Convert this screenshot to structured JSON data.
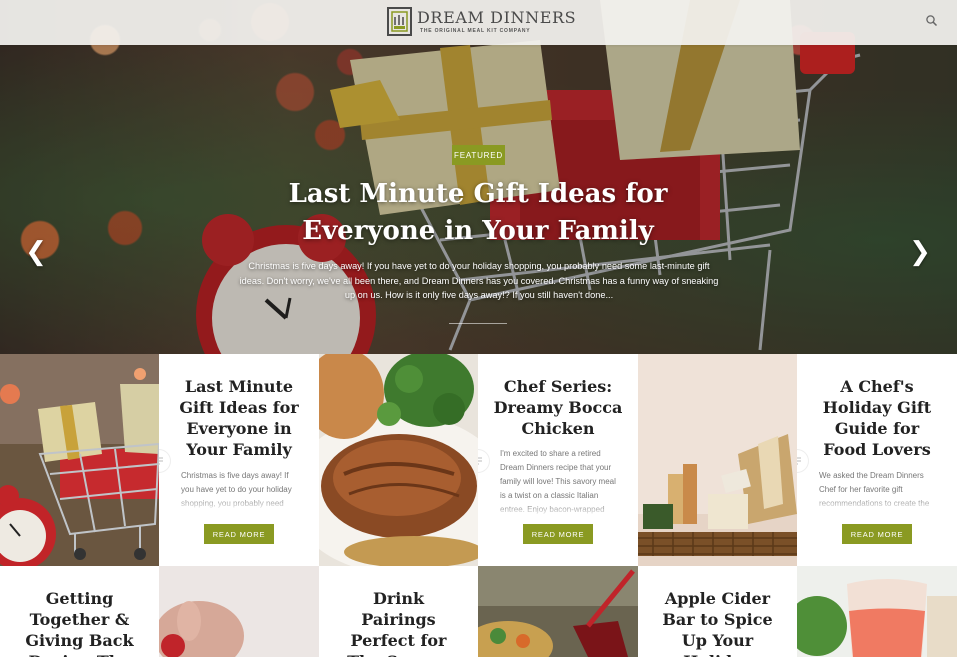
{
  "brand": {
    "name": "DREAM DINNERS",
    "tagline": "THE ORIGINAL MEAL KIT COMPANY"
  },
  "header": {
    "search_icon": "search-icon"
  },
  "hero": {
    "badge": "FEATURED",
    "title": "Last Minute Gift Ideas for Everyone in Your Family",
    "excerpt": "Christmas is five days away! If you have yet to do your holiday shopping, you probably need some last-minute gift ideas. Don't worry, we've all been there, and Dream Dinners has you covered. Christmas has a funny way of sneaking up on us. How is it only five days away!? If you still haven't done...",
    "prev_icon": "chevron-left-icon",
    "next_icon": "chevron-right-icon"
  },
  "posts": [
    {
      "title": "Last Minute Gift Ideas for Everyone in Your Family",
      "excerpt": "Christmas is five days away! If you have yet to do your holiday shopping, you probably need",
      "cta": "READ MORE"
    },
    {
      "title": "Chef Series: Dreamy Bocca Chicken",
      "excerpt": "I'm excited to share a retired Dream Dinners recipe that your family will love! This savory meal is a twist on a classic Italian entree. Enjoy bacon-wrapped",
      "cta": "READ MORE"
    },
    {
      "title": "A Chef's Holiday Gift Guide for Food Lovers",
      "excerpt": "We asked the Dream Dinners Chef for her favorite gift recommendations to create the",
      "cta": "READ MORE"
    },
    {
      "title": "Getting Together & Giving Back During The"
    },
    {
      "title": "Drink Pairings Perfect for The Season"
    },
    {
      "title": "Apple Cider Bar to Spice Up Your Holiday"
    }
  ],
  "colors": {
    "accent": "#8a9a22",
    "title": "#222222",
    "excerpt": "#777777"
  }
}
